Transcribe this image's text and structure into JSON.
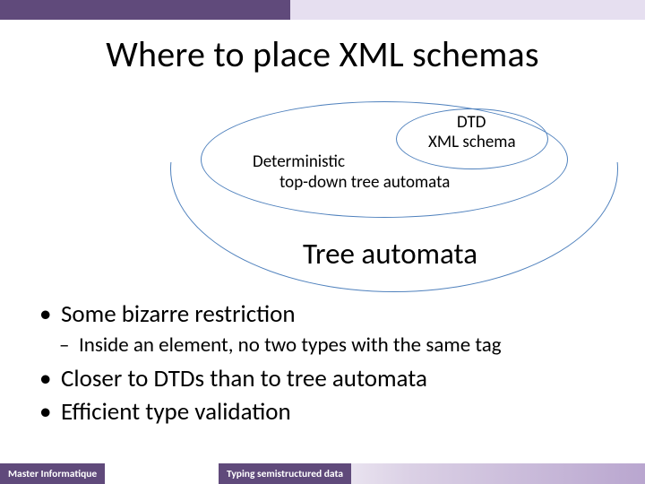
{
  "title": "Where to place XML schemas",
  "diagram": {
    "dtd": "DTD",
    "xmlschema": "XML schema",
    "deterministic": "Deterministic",
    "topdown": "top-down tree automata",
    "tree": "Tree automata"
  },
  "bullets": {
    "item1": "Some bizarre restriction",
    "sub1": "Inside an element, no two types with the same tag",
    "item2": "Closer to DTDs than to tree automata",
    "item3": "Efficient type validation"
  },
  "footer": {
    "left": "Master Informatique",
    "center": "Typing semistructured data"
  }
}
